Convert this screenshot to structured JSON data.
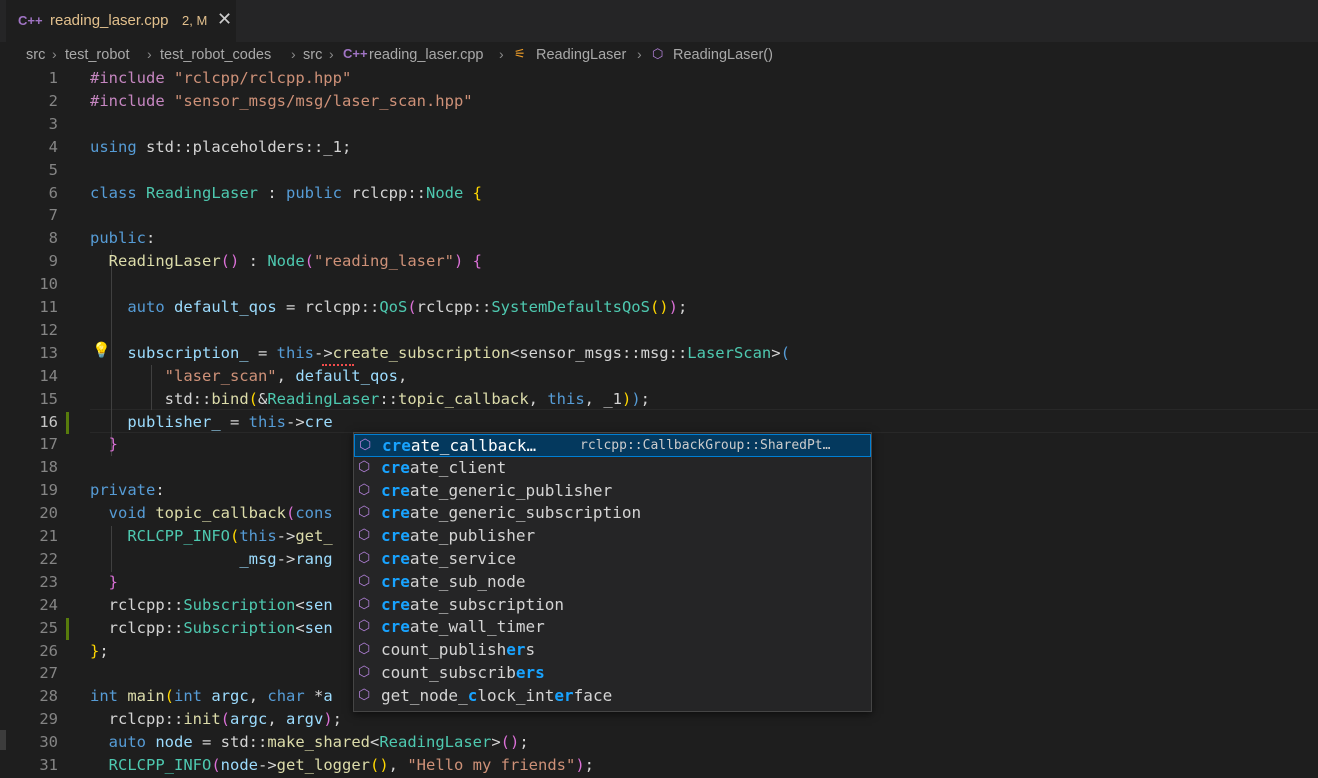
{
  "tab": {
    "icon": "cpp-file-icon",
    "icon_text": "C++",
    "filename": "reading_laser.cpp",
    "status": "2, M"
  },
  "breadcrumb": {
    "items": [
      "src",
      "test_robot",
      "test_robot_codes",
      "src",
      "reading_laser.cpp",
      "ReadingLaser",
      "ReadingLaser()"
    ],
    "icons": [
      "cpp-file-icon",
      "class-icon",
      "method-icon"
    ]
  },
  "editor": {
    "lines": [
      {
        "n": "1",
        "html": "<span class='m'>#include</span> <span class='s'>\"rclcpp/rclcpp.hpp\"</span>"
      },
      {
        "n": "2",
        "html": "<span class='m'>#include</span> <span class='s'>\"sensor_msgs/msg/laser_scan.hpp\"</span>"
      },
      {
        "n": "3",
        "html": ""
      },
      {
        "n": "4",
        "html": "<span class='k'>using</span> std::placeholders::_1;"
      },
      {
        "n": "5",
        "html": ""
      },
      {
        "n": "6",
        "html": "<span class='k'>class</span> <span class='t'>ReadingLaser</span> : <span class='k'>public</span> rclcpp::<span class='t'>Node</span> <span class='p'>{</span>"
      },
      {
        "n": "7",
        "html": ""
      },
      {
        "n": "8",
        "html": "<span class='k'>public</span>:"
      },
      {
        "n": "9",
        "html": "  <span class='f'>ReadingLaser</span><span class='q'>()</span> : <span class='t'>Node</span><span class='q'>(</span><span class='s'>\"reading_laser\"</span><span class='q'>)</span> <span class='q'>{</span>"
      },
      {
        "n": "10",
        "html": ""
      },
      {
        "n": "11",
        "html": "    <span class='k'>auto</span> <span class='v'>default_qos</span> = rclcpp::<span class='t'>QoS</span><span class='q'>(</span>rclcpp::<span class='t'>SystemDefaultsQoS</span><span class='p'>()</span><span class='q'>)</span>;"
      },
      {
        "n": "12",
        "html": ""
      },
      {
        "n": "13",
        "html": "    <span class='v'>subscription_</span> = <span class='k'>this</span>-><span class='f'>create_subscription</span>&lt;sensor_msgs::msg::<span class='t'>LaserScan</span>&gt;<span class='k'>(</span>"
      },
      {
        "n": "14",
        "html": "        <span class='s'>\"laser_scan\"</span>, <span class='v'>default_qos</span>,"
      },
      {
        "n": "15",
        "html": "        std::<span class='f'>bind</span><span class='p'>(</span>&amp;<span class='t'>ReadingLaser</span>::<span class='f'>topic_callback</span>, <span class='k'>this</span>, _1<span class='p'>)</span><span class='k'>)</span>;"
      },
      {
        "n": "16",
        "html": "    <span class='v'>publisher_</span> = <span class='k'>this</span>-><span class='v'>cre</span>"
      },
      {
        "n": "17",
        "html": "  <span class='q'>}</span>"
      },
      {
        "n": "18",
        "html": ""
      },
      {
        "n": "19",
        "html": "<span class='k'>private</span>:"
      },
      {
        "n": "20",
        "html": "  <span class='k'>void</span> <span class='f'>topic_callback</span><span class='q'>(</span><span class='k'>cons</span>"
      },
      {
        "n": "21",
        "html": "    <span class='t'>RCLCPP_INFO</span><span class='p'>(</span><span class='k'>this</span>-><span class='f'>get_</span>"
      },
      {
        "n": "22",
        "html": "                <span class='v'>_msg</span>-><span class='v'>rang</span>"
      },
      {
        "n": "23",
        "html": "  <span class='q'>}</span>"
      },
      {
        "n": "24",
        "html": "  rclcpp::<span class='t'>Subscription</span>&lt;<span class='v'>sen</span>"
      },
      {
        "n": "25",
        "html": "  rclcpp::<span class='t'>Subscription</span>&lt;<span class='v'>sen</span>"
      },
      {
        "n": "26",
        "html": "<span class='p'>}</span>;"
      },
      {
        "n": "27",
        "html": ""
      },
      {
        "n": "28",
        "html": "<span class='k'>int</span> <span class='f'>main</span><span class='p'>(</span><span class='k'>int</span> <span class='v'>argc</span>, <span class='k'>char</span> *<span class='v'>a</span>"
      },
      {
        "n": "29",
        "html": "  rclcpp::<span class='f'>init</span><span class='q'>(</span><span class='v'>argc</span>, <span class='v'>argv</span><span class='q'>)</span>;"
      },
      {
        "n": "30",
        "html": "  <span class='k'>auto</span> <span class='v'>node</span> = std::<span class='f'>make_shared</span>&lt;<span class='t'>ReadingLaser</span>&gt;<span class='q'>()</span>;"
      },
      {
        "n": "31",
        "html": "  <span class='t'>RCLCPP_INFO</span><span class='q'>(</span><span class='v'>node</span>-><span class='f'>get_logger</span><span class='p'>()</span>, <span class='s'>\"Hello my friends\"</span><span class='q'>)</span>;"
      }
    ],
    "modified_lines": [
      "16",
      "25"
    ]
  },
  "suggestions": {
    "items": [
      {
        "label": "create_callback…",
        "match": "cre",
        "rest": "ate_callback…",
        "detail": "rclcpp::CallbackGroup::SharedPt…",
        "selected": true
      },
      {
        "label": "create_client",
        "match": "cre",
        "rest": "ate_client"
      },
      {
        "label": "create_generic_publisher",
        "match": "cre",
        "rest": "ate_generic_publisher"
      },
      {
        "label": "create_generic_subscription",
        "match": "cre",
        "rest": "ate_generic_subscription"
      },
      {
        "label": "create_publisher",
        "match": "cre",
        "rest": "ate_publisher"
      },
      {
        "label": "create_service",
        "match": "cre",
        "rest": "ate_service"
      },
      {
        "label": "create_sub_node",
        "match": "cre",
        "rest": "ate_sub_node"
      },
      {
        "label": "create_subscription",
        "match": "cre",
        "rest": "ate_subscription"
      },
      {
        "label": "create_wall_timer",
        "match": "cre",
        "rest": "ate_wall_timer"
      },
      {
        "label": "count_publishers",
        "parts": [
          "count_publish",
          "er",
          "s"
        ]
      },
      {
        "label": "count_subscribers",
        "parts": [
          "count_subscrib",
          "ers",
          ""
        ]
      },
      {
        "label": "get_node_clock_interface",
        "parts": [
          "get_node_",
          "c",
          "lock_int",
          "er",
          "face"
        ]
      }
    ],
    "icon": "method-cube-icon"
  },
  "colors": {
    "background": "#1e1e1e",
    "keyword": "#569cd6",
    "string": "#ce9178",
    "type": "#4ec9b0",
    "function": "#dcdcaa",
    "match_highlight": "#18a3ff"
  }
}
